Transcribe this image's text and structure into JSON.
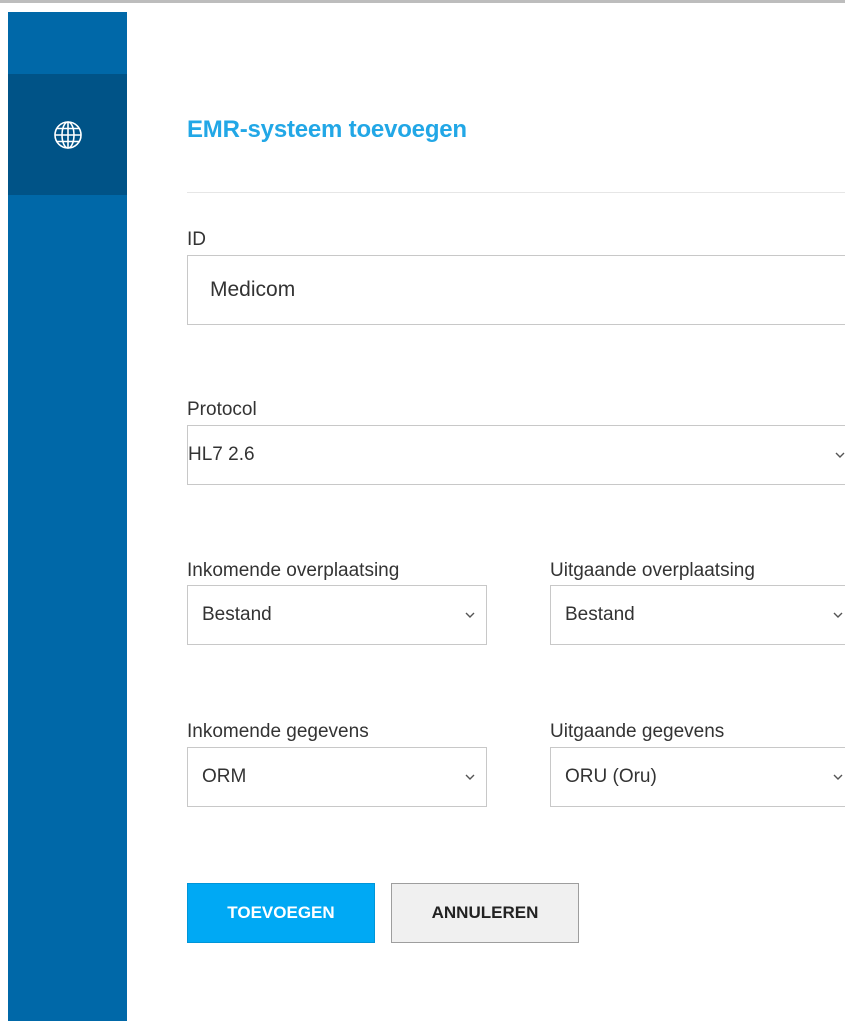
{
  "sidebar": {
    "items": [
      {
        "icon": "globe-icon",
        "active": true
      }
    ],
    "colors": {
      "background": "#0068a8",
      "active": "#005387"
    }
  },
  "form": {
    "title": "EMR-systeem toevoegen",
    "id_field": {
      "label": "ID",
      "value": "Medicom"
    },
    "protocol": {
      "label": "Protocol",
      "value": "HL7 2.6"
    },
    "incoming_transfer": {
      "label": "Inkomende overplaatsing",
      "value": "Bestand"
    },
    "outgoing_transfer": {
      "label": "Uitgaande overplaatsing",
      "value": "Bestand"
    },
    "incoming_data": {
      "label": "Inkomende gegevens",
      "value": "ORM"
    },
    "outgoing_data": {
      "label": "Uitgaande gegevens",
      "value": "ORU (Oru)"
    },
    "buttons": {
      "add": "TOEVOEGEN",
      "cancel": "ANNULEREN"
    }
  },
  "colors": {
    "accent": "#22a7e6",
    "primary_button": "#00a9f4"
  }
}
